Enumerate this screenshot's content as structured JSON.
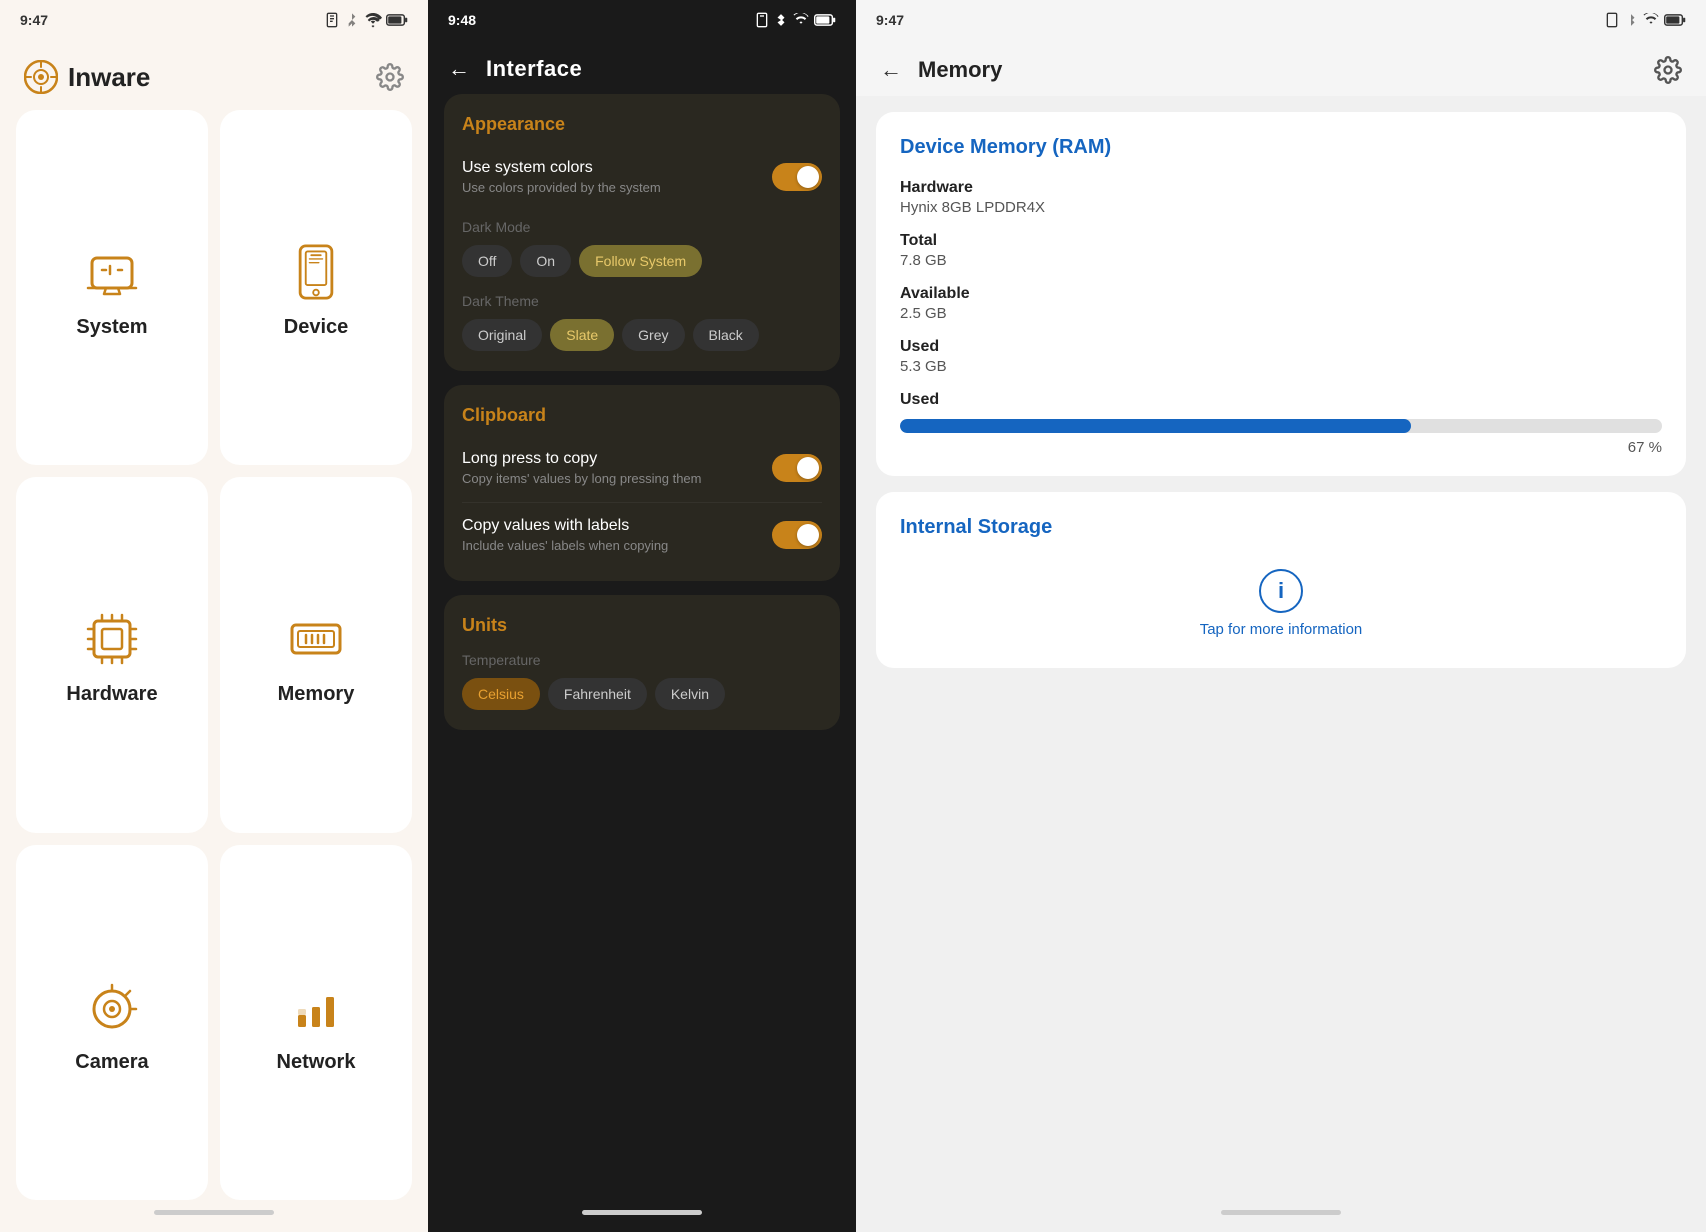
{
  "panel1": {
    "statusbar": {
      "time": "9:47",
      "icons": "🔋"
    },
    "title": "Inware",
    "settings_label": "⚙",
    "menu": [
      {
        "id": "system",
        "label": "System",
        "icon": "system"
      },
      {
        "id": "device",
        "label": "Device",
        "icon": "device"
      },
      {
        "id": "hardware",
        "label": "Hardware",
        "icon": "hardware"
      },
      {
        "id": "memory",
        "label": "Memory",
        "icon": "memory"
      },
      {
        "id": "camera",
        "label": "Camera",
        "icon": "camera"
      },
      {
        "id": "network",
        "label": "Network",
        "icon": "network"
      }
    ]
  },
  "panel2": {
    "statusbar": {
      "time": "9:48"
    },
    "title": "Interface",
    "sections": [
      {
        "id": "appearance",
        "title": "Appearance",
        "items": [
          {
            "id": "use-system-colors",
            "label": "Use system colors",
            "sublabel": "Use colors provided by the system",
            "toggle": true,
            "toggle_on": true
          },
          {
            "id": "dark-mode",
            "label": "Dark Mode",
            "type": "chips",
            "chips": [
              "Off",
              "On",
              "Follow System"
            ],
            "active": "Follow System"
          },
          {
            "id": "dark-theme",
            "label": "Dark Theme",
            "type": "chips",
            "chips": [
              "Original",
              "Slate",
              "Grey",
              "Black"
            ],
            "active": "Slate"
          }
        ]
      },
      {
        "id": "clipboard",
        "title": "Clipboard",
        "items": [
          {
            "id": "long-press-copy",
            "label": "Long press to copy",
            "sublabel": "Copy items' values by long pressing them",
            "toggle": true,
            "toggle_on": true
          },
          {
            "id": "copy-with-labels",
            "label": "Copy values with labels",
            "sublabel": "Include values' labels when copying",
            "toggle": true,
            "toggle_on": true
          }
        ]
      },
      {
        "id": "units",
        "title": "Units",
        "items": [
          {
            "id": "temperature",
            "label": "Temperature",
            "type": "chips",
            "chips": [
              "Celsius",
              "Fahrenheit",
              "Kelvin"
            ],
            "active": "Celsius"
          }
        ]
      }
    ]
  },
  "panel3": {
    "statusbar": {
      "time": "9:47"
    },
    "title": "Memory",
    "back_label": "←",
    "ram": {
      "section_title": "Device Memory (RAM)",
      "hardware_label": "Hardware",
      "hardware_value": "Hynix 8GB LPDDR4X",
      "total_label": "Total",
      "total_value": "7.8 GB",
      "available_label": "Available",
      "available_value": "2.5 GB",
      "used_label": "Used",
      "used_value": "5.3 GB",
      "progress_label": "Used",
      "progress_pct": "67 %",
      "progress_fill": 67
    },
    "storage": {
      "section_title": "Internal Storage",
      "tap_label": "Tap for more information"
    }
  }
}
